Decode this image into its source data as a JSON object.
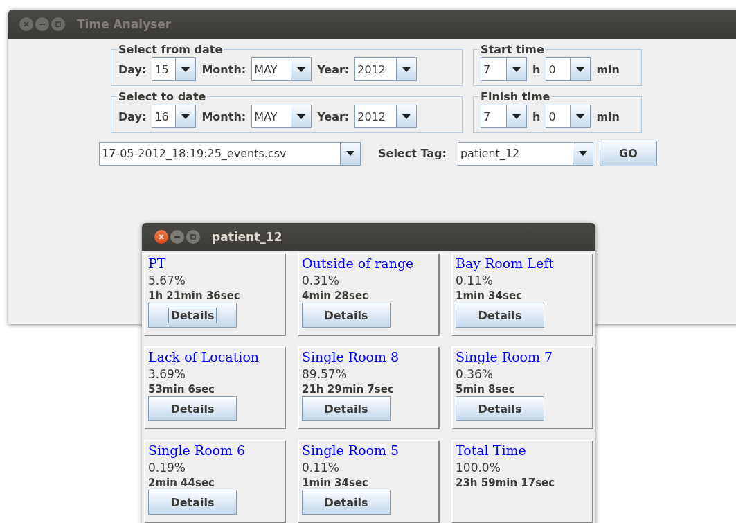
{
  "main_window": {
    "title": "Time Analyser",
    "active": false
  },
  "date_groups": [
    {
      "legend": "Select from date",
      "fields": [
        {
          "label": "Day:",
          "value": "15",
          "kind": "day"
        },
        {
          "label": "Month:",
          "value": "MAY",
          "kind": "month"
        },
        {
          "label": "Year:",
          "value": "2012",
          "kind": "year"
        }
      ]
    },
    {
      "legend": "Select to date",
      "fields": [
        {
          "label": "Day:",
          "value": "16",
          "kind": "day"
        },
        {
          "label": "Month:",
          "value": "MAY",
          "kind": "month"
        },
        {
          "label": "Year:",
          "value": "2012",
          "kind": "year"
        }
      ]
    }
  ],
  "time_groups": [
    {
      "legend": "Start time",
      "hour": "7",
      "hour_unit": "h",
      "minute": "0",
      "minute_unit": "min"
    },
    {
      "legend": "Finish time",
      "hour": "7",
      "hour_unit": "h",
      "minute": "0",
      "minute_unit": "min"
    }
  ],
  "file_select": "17-05-2012_18:19:25_events.csv",
  "tag_label": "Select Tag:",
  "tag_select": "patient_12",
  "go_button": "GO",
  "popup": {
    "title": "patient_12",
    "active": true,
    "cells": [
      {
        "name": "PT",
        "percent": "5.67%",
        "duration": "1h 21min 36sec",
        "button": "Details",
        "focused": true
      },
      {
        "name": "Outside of range",
        "percent": "0.31%",
        "duration": "4min 28sec",
        "button": "Details",
        "focused": false
      },
      {
        "name": "Bay Room Left",
        "percent": "0.11%",
        "duration": "1min 34sec",
        "button": "Details",
        "focused": false
      },
      {
        "name": "Lack of Location",
        "percent": "3.69%",
        "duration": "53min 6sec",
        "button": "Details",
        "focused": false
      },
      {
        "name": "Single Room 8",
        "percent": "89.57%",
        "duration": "21h 29min 7sec",
        "button": "Details",
        "focused": false
      },
      {
        "name": "Single Room 7",
        "percent": "0.36%",
        "duration": "5min 8sec",
        "button": "Details",
        "focused": false
      },
      {
        "name": "Single Room 6",
        "percent": "0.19%",
        "duration": "2min 44sec",
        "button": "Details",
        "focused": false
      },
      {
        "name": "Single Room 5",
        "percent": "0.11%",
        "duration": "1min 34sec",
        "button": "Details",
        "focused": false
      },
      {
        "name": "Total Time",
        "percent": "100.0%",
        "duration": "23h 59min 17sec"
      }
    ]
  }
}
